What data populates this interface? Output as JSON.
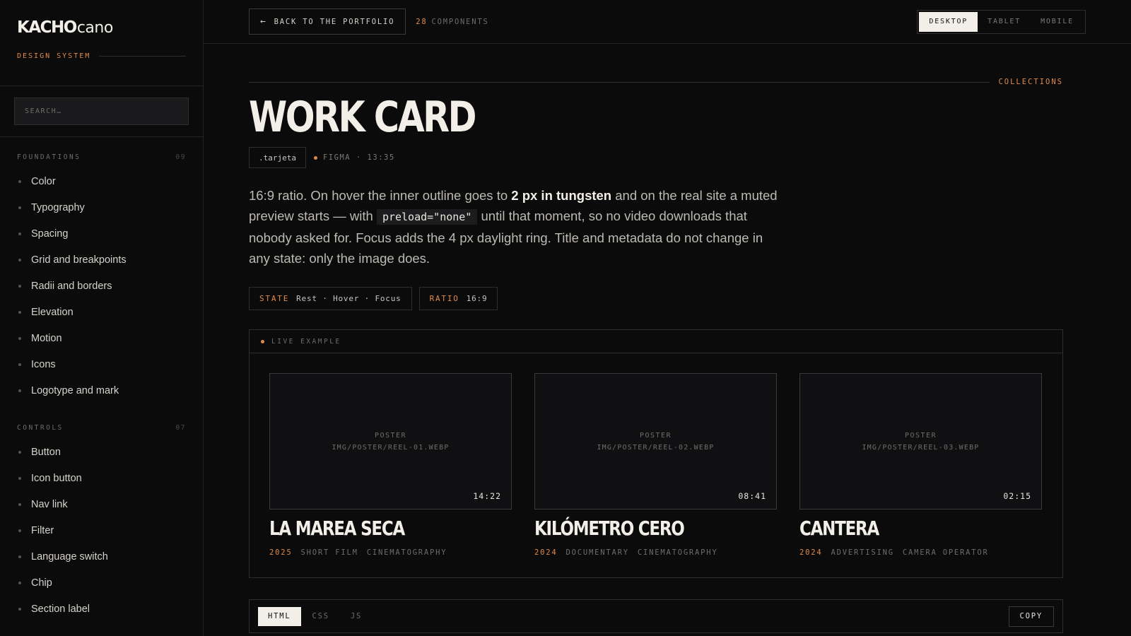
{
  "brand": {
    "logo_bold": "KACHO",
    "logo_light": "cano",
    "subtitle": "DESIGN SYSTEM"
  },
  "search": {
    "placeholder": "SEARCH…"
  },
  "sidebar": {
    "groups": [
      {
        "title": "FOUNDATIONS",
        "count": "09",
        "items": [
          "Color",
          "Typography",
          "Spacing",
          "Grid and breakpoints",
          "Radii and borders",
          "Elevation",
          "Motion",
          "Icons",
          "Logotype and mark"
        ]
      },
      {
        "title": "CONTROLS",
        "count": "07",
        "items": [
          "Button",
          "Icon button",
          "Nav link",
          "Filter",
          "Language switch",
          "Chip",
          "Section label"
        ]
      }
    ]
  },
  "topbar": {
    "back_label": "BACK TO THE PORTFOLIO",
    "component_count": "28",
    "component_label": "COMPONENTS",
    "viewports": [
      "DESKTOP",
      "TABLET",
      "MOBILE"
    ],
    "active_viewport": "DESKTOP"
  },
  "page": {
    "section_label": "COLLECTIONS",
    "title": "WORK CARD",
    "class_tag": ".tarjeta",
    "figma_ref": "FIGMA · 13:35",
    "desc": {
      "p1": "16:9 ratio. On hover the inner outline goes to ",
      "strong": "2 px in tungsten",
      "p2": " and on the real site a muted preview starts — with ",
      "code": "preload=\"none\"",
      "p3": " until that moment, so no video downloads that nobody asked for. Focus adds the 4 px daylight ring. Title and metadata do not change in any state: only the image does."
    },
    "chips": [
      {
        "key": "STATE",
        "value": "Rest · Hover · Focus"
      },
      {
        "key": "RATIO",
        "value": "16:9"
      }
    ]
  },
  "example": {
    "label": "LIVE EXAMPLE",
    "cards": [
      {
        "poster_label": "POSTER",
        "poster_path": "IMG/POSTER/REEL-01.WEBP",
        "duration": "14:22",
        "title": "LA MAREA SECA",
        "year": "2025",
        "tags": [
          "SHORT FILM",
          "CINEMATOGRAPHY"
        ]
      },
      {
        "poster_label": "POSTER",
        "poster_path": "IMG/POSTER/REEL-02.WEBP",
        "duration": "08:41",
        "title": "KILÓMETRO CERO",
        "year": "2024",
        "tags": [
          "DOCUMENTARY",
          "CINEMATOGRAPHY"
        ]
      },
      {
        "poster_label": "POSTER",
        "poster_path": "IMG/POSTER/REEL-03.WEBP",
        "duration": "02:15",
        "title": "CANTERA",
        "year": "2024",
        "tags": [
          "ADVERTISING",
          "CAMERA OPERATOR"
        ]
      }
    ]
  },
  "code": {
    "tabs": [
      "HTML",
      "CSS",
      "JS"
    ],
    "active_tab": "HTML",
    "copy_label": "COPY"
  },
  "colors": {
    "accent": "#e08a4a",
    "background": "#0b0b0c",
    "text": "#e9e6df"
  },
  "icons": {
    "back": "arrow-left-icon"
  }
}
